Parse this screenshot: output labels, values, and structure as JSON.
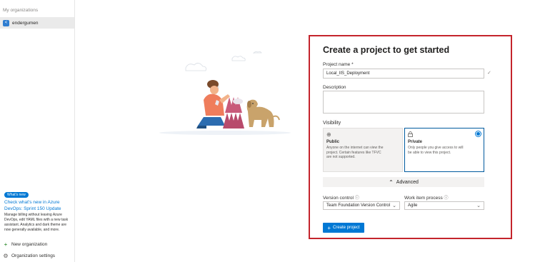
{
  "sidebar": {
    "heading": "My organizations",
    "org_initial": "<",
    "org_name": "endergumen",
    "whats_new_badge": "What's new",
    "news_link": "Check what's new in Azure DevOps: Sprint 150 Update",
    "news_body": "Manage billing without leaving Azure DevOps, edit YAML files with a new task assistant. Analytics and dark theme are now generally available, and more.",
    "new_org": "New organization",
    "org_settings": "Organization settings"
  },
  "form": {
    "title": "Create a project to get started",
    "project_name_label": "Project name *",
    "project_name_value": "Local_IIS_Deployment",
    "description_label": "Description",
    "description_value": "",
    "visibility_label": "Visibility",
    "public": {
      "name": "Public",
      "desc": "Anyone on the internet can view the project. Certain features like TFVC are not supported.",
      "icon": "globe-icon"
    },
    "private": {
      "name": "Private",
      "desc": "Only people you give access to will be able to view this project.",
      "icon": "lock-icon",
      "selected": true
    },
    "advanced_label": "Advanced",
    "version_control_label": "Version control",
    "version_control_value": "Team Foundation Version Control",
    "work_item_label": "Work item process",
    "work_item_value": "Agile",
    "create_button": "Create project"
  },
  "colors": {
    "accent": "#0078d4",
    "highlight_border": "#c4242c"
  }
}
